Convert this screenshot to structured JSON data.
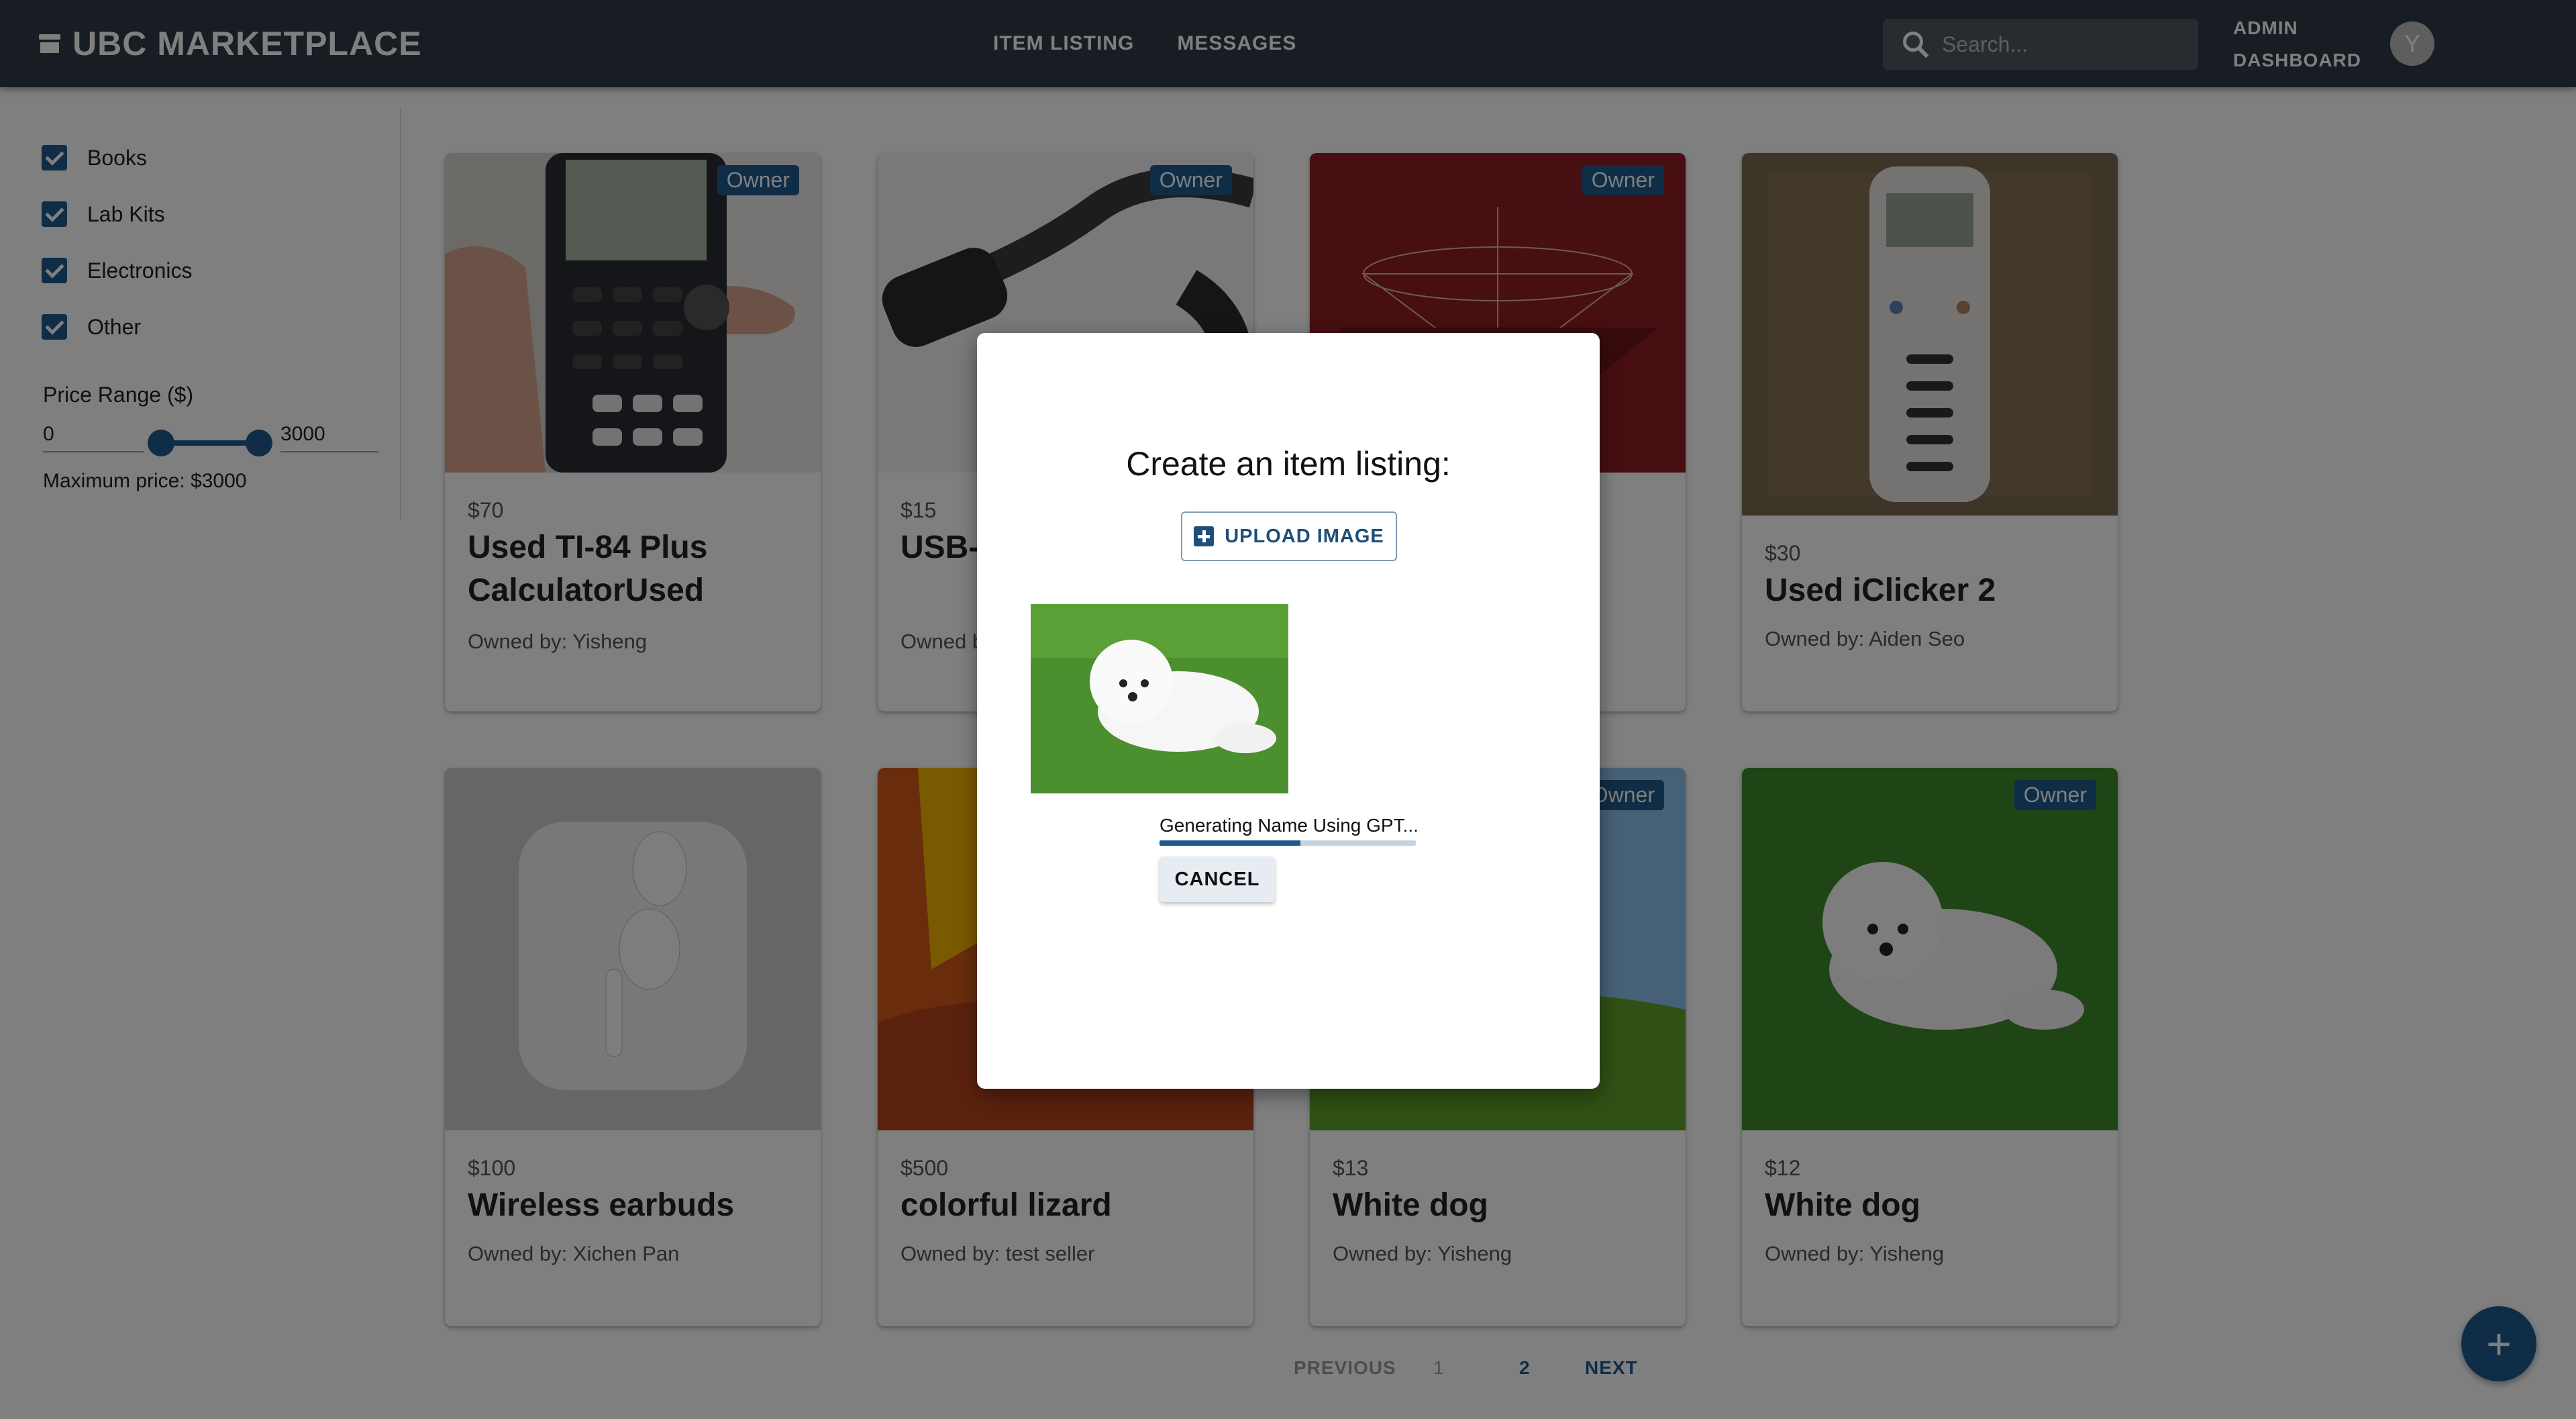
{
  "header": {
    "brand": "UBC MARKETPLACE",
    "nav": [
      "ITEM LISTING",
      "MESSAGES"
    ],
    "search_placeholder": "Search...",
    "admin_line1": "ADMIN",
    "admin_line2": "DASHBOARD",
    "avatar_initial": "Y",
    "bar_color": "#2f3b47"
  },
  "sidebar": {
    "categories": [
      "Books",
      "Lab Kits",
      "Electronics",
      "Other"
    ],
    "price_label": "Price Range ($)",
    "price_min": "0",
    "price_max": "3000",
    "max_price_text": "Maximum price: $3000",
    "accent": "#1f5a8c"
  },
  "cards": [
    {
      "price": "$70",
      "name": "Used TI-84 Plus CalculatorUsed",
      "owner": "Owned by: Yisheng",
      "badge": "Owner"
    },
    {
      "price": "$15",
      "name": "USB-C Adapter",
      "owner": "Owned by:",
      "badge": "Owner"
    },
    {
      "price": "",
      "name": "",
      "owner": "",
      "badge": "Owner"
    },
    {
      "price": "$30",
      "name": "Used iClicker 2",
      "owner": "Owned by: Aiden Seo",
      "badge": ""
    },
    {
      "price": "$100",
      "name": "Wireless earbuds",
      "owner": "Owned by: Xichen Pan",
      "badge": ""
    },
    {
      "price": "$500",
      "name": "colorful lizard",
      "owner": "Owned by: test seller",
      "badge": ""
    },
    {
      "price": "$13",
      "name": "White dog",
      "owner": "Owned by: Yisheng",
      "badge": "Owner"
    },
    {
      "price": "$12",
      "name": "White dog",
      "owner": "Owned by: Yisheng",
      "badge": "Owner"
    }
  ],
  "pagination": {
    "previous": "PREVIOUS",
    "page1": "1",
    "page2": "2",
    "next": "NEXT"
  },
  "fab_label": "+",
  "modal": {
    "title": "Create an item listing:",
    "upload_label": "UPLOAD IMAGE",
    "status": "Generating Name Using GPT...",
    "progress": 0.55,
    "cancel_label": "CANCEL"
  }
}
